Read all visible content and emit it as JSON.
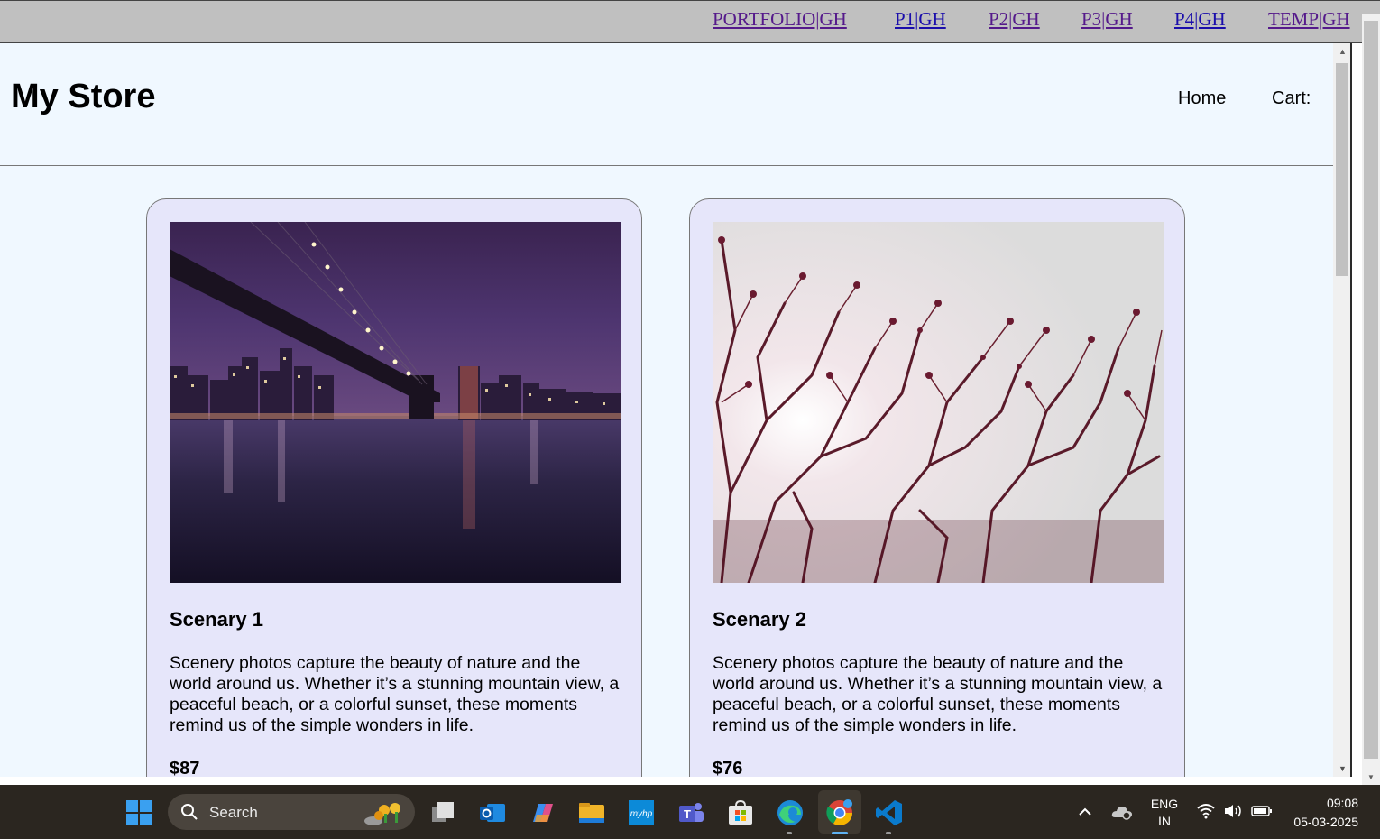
{
  "top_links": [
    {
      "label": "PORTFOLIO|GH"
    },
    {
      "label": "P1|GH"
    },
    {
      "label": "P2|GH"
    },
    {
      "label": "P3|GH"
    },
    {
      "label": "P4|GH"
    },
    {
      "label": "TEMP|GH"
    }
  ],
  "store": {
    "title": "My Store",
    "nav": {
      "home": "Home",
      "cart": "Cart:"
    }
  },
  "products": [
    {
      "name": "Scenary 1",
      "description": "Scenery photos capture the beauty of nature and the world around us. Whether it’s a stunning mountain view, a peaceful beach, or a colorful sunset, these moments remind us of the simple wonders in life.",
      "price": "$87"
    },
    {
      "name": "Scenary 2",
      "description": "Scenery photos capture the beauty of nature and the world around us. Whether it’s a stunning mountain view, a peaceful beach, or a colorful sunset, these moments remind us of the simple wonders in life.",
      "price": "$76"
    }
  ],
  "taskbar": {
    "search_label": "Search",
    "apps": [
      "start-icon",
      "task-view-icon",
      "outlook-icon",
      "copilot-icon",
      "file-explorer-icon",
      "myhp-icon",
      "teams-icon",
      "store-icon",
      "edge-icon",
      "chrome-icon",
      "vscode-icon"
    ],
    "language": {
      "line1": "ENG",
      "line2": "IN"
    },
    "time": "09:08",
    "date": "05-03-2025"
  }
}
